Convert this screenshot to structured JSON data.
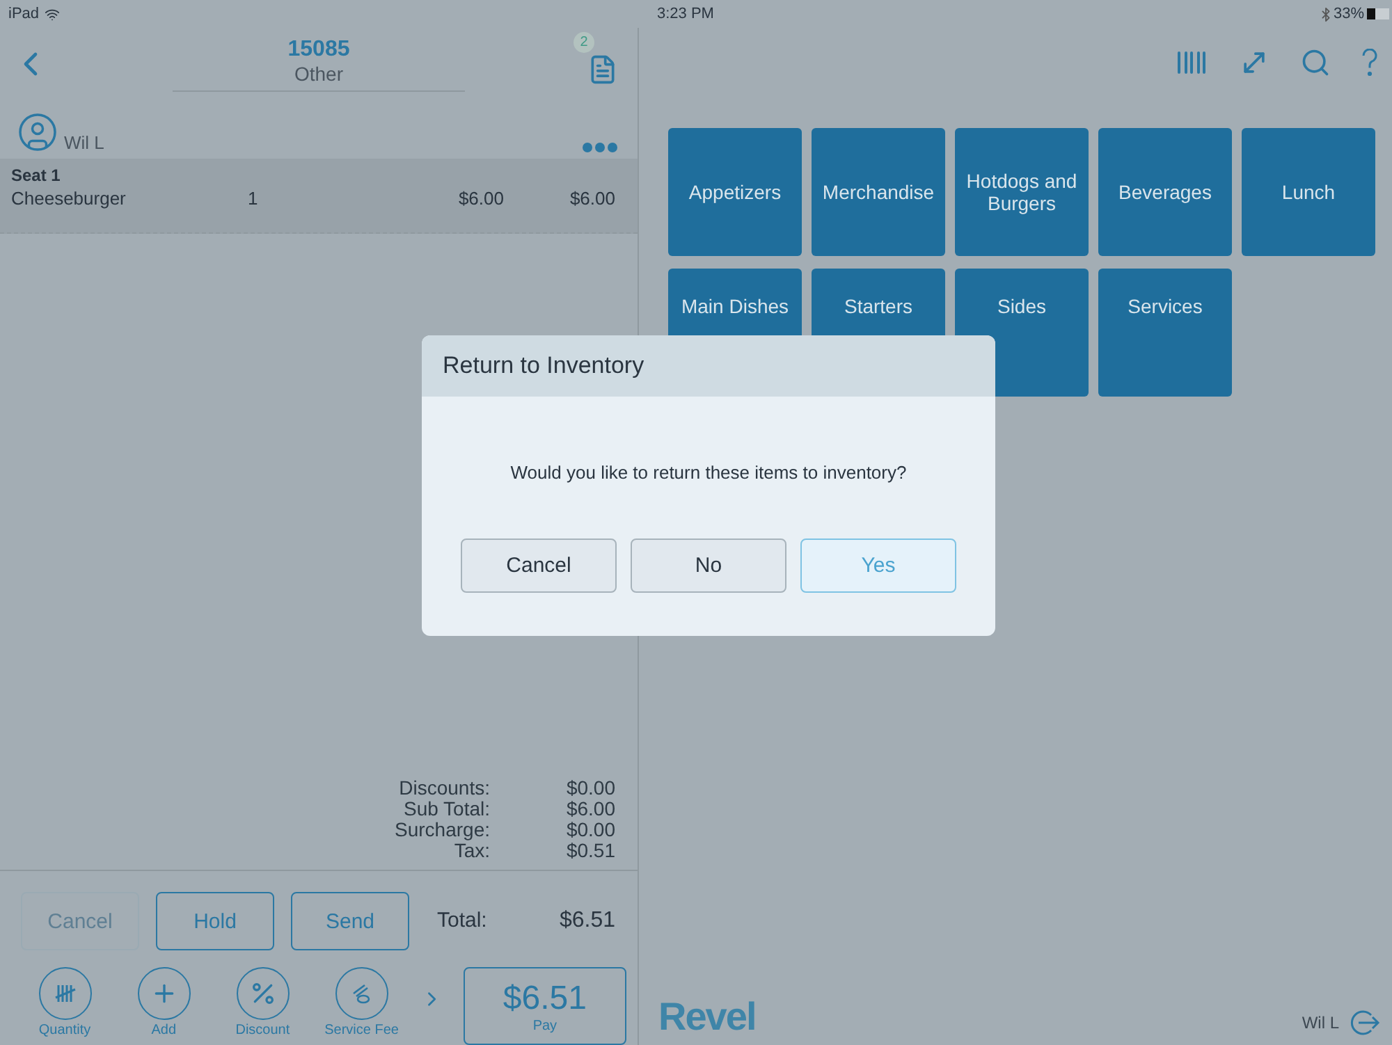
{
  "status_bar": {
    "carrier": "iPad",
    "time": "3:23 PM",
    "battery": "33%"
  },
  "order": {
    "number": "15085",
    "type": "Other",
    "badge": "2",
    "customer": "Wil L",
    "seat": "Seat 1",
    "items": [
      {
        "name": "Cheeseburger",
        "qty": "1",
        "price": "$6.00",
        "total": "$6.00"
      }
    ],
    "totals": [
      {
        "label": "Discounts:",
        "value": "$0.00"
      },
      {
        "label": "Sub Total:",
        "value": "$6.00"
      },
      {
        "label": "Surcharge:",
        "value": "$0.00"
      },
      {
        "label": "Tax:",
        "value": "$0.51"
      }
    ],
    "total_label": "Total:",
    "total_value": "$6.51"
  },
  "actions": [
    {
      "label": "Cancel",
      "disabled": true
    },
    {
      "label": "Hold",
      "disabled": false
    },
    {
      "label": "Send",
      "disabled": false
    }
  ],
  "tools": [
    {
      "label": "Quantity",
      "kind": "tally"
    },
    {
      "label": "Add",
      "kind": "plus"
    },
    {
      "label": "Discount",
      "kind": "percent"
    },
    {
      "label": "Service Fee",
      "kind": "fee"
    }
  ],
  "pay": {
    "amount": "$6.51",
    "label": "Pay"
  },
  "categories": [
    {
      "label": "Appetizers"
    },
    {
      "label": "Merchandise"
    },
    {
      "label": "Hotdogs and Burgers"
    },
    {
      "label": "Beverages"
    },
    {
      "label": "Lunch"
    },
    {
      "label": "Main Dishes"
    },
    {
      "label": "Starters"
    },
    {
      "label": "Sides"
    },
    {
      "label": "Services"
    }
  ],
  "footer": {
    "brand": "Revel",
    "user": "Wil L"
  },
  "dialog": {
    "title": "Return to Inventory",
    "message": "Would you like to return these items to inventory?",
    "buttons": [
      {
        "label": "Cancel",
        "primary": false
      },
      {
        "label": "No",
        "primary": false
      },
      {
        "label": "Yes",
        "primary": true
      }
    ]
  }
}
